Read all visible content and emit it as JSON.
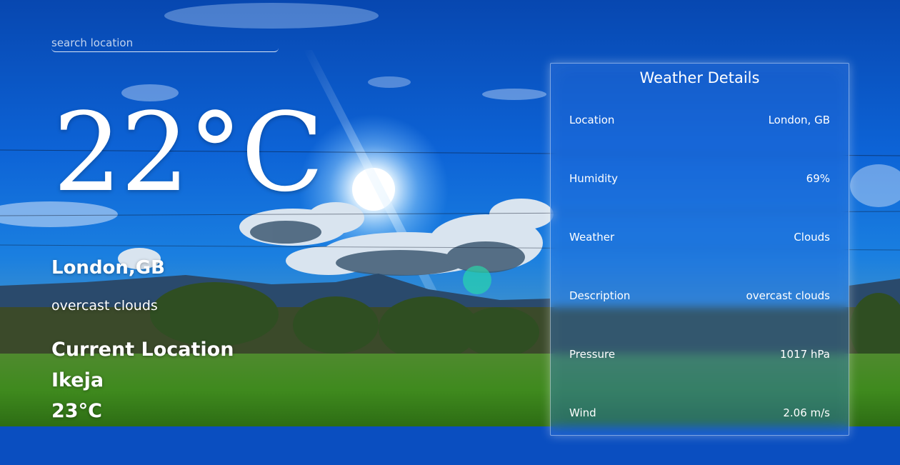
{
  "search": {
    "placeholder": "search location"
  },
  "main": {
    "temperature": "22°C",
    "location": "London,GB",
    "description": "overcast clouds"
  },
  "current": {
    "label": "Current Location",
    "city": "Ikeja",
    "temperature": "23°C"
  },
  "details": {
    "title": "Weather Details",
    "rows": [
      {
        "label": "Location",
        "value": "London, GB"
      },
      {
        "label": "Humidity",
        "value": "69%"
      },
      {
        "label": "Weather",
        "value": "Clouds"
      },
      {
        "label": "Description",
        "value": "overcast clouds"
      },
      {
        "label": "Pressure",
        "value": "1017 hPa"
      },
      {
        "label": "Wind",
        "value": "2.06 m/s"
      }
    ]
  }
}
